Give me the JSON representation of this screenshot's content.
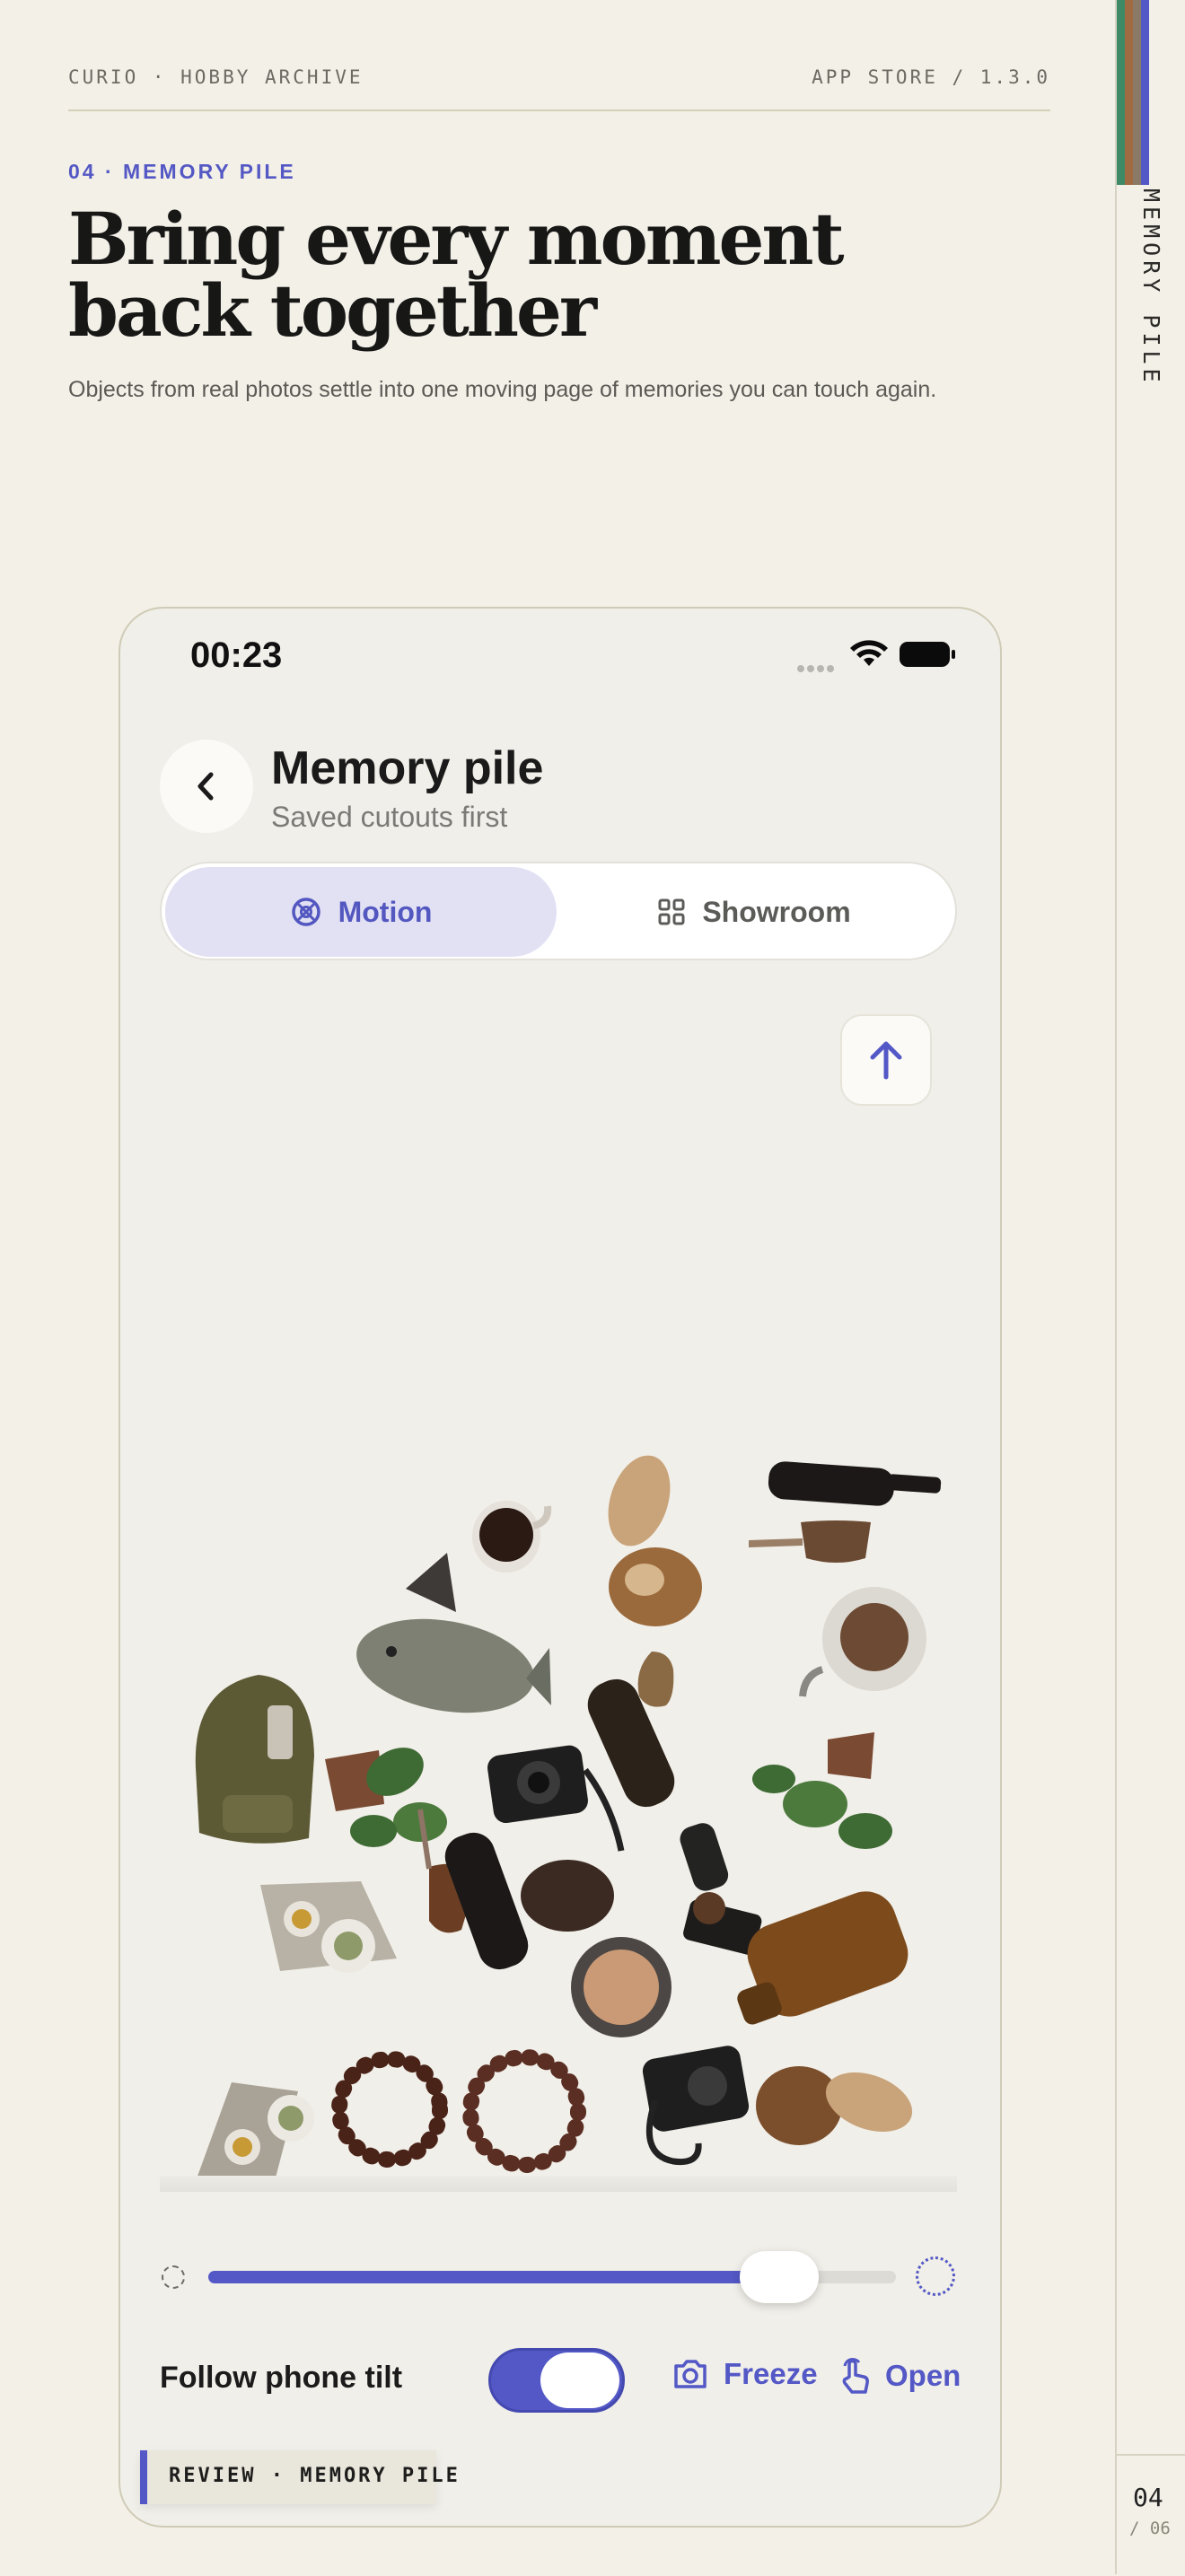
{
  "header": {
    "brand": "CURIO · HOBBY ARCHIVE",
    "release": "APP STORE / 1.3.0",
    "kicker": "04 · MEMORY PILE",
    "headline_line1": "Bring every moment",
    "headline_line2": "back together",
    "subtitle": "Objects from real photos settle into one moving page of memories you can touch again."
  },
  "sidebar": {
    "label": "MEMORY PILE",
    "page_number": "04",
    "page_total": "/ 06",
    "swatches": [
      "#3e8a67",
      "#a06a42",
      "#8a7a65",
      "#5358c6"
    ]
  },
  "status_bar": {
    "time": "00:23"
  },
  "screen": {
    "title": "Memory pile",
    "subtitle": "Saved cutouts first",
    "tabs": [
      {
        "label": "Motion",
        "icon": "motion-icon",
        "selected": true
      },
      {
        "label": "Showroom",
        "icon": "grid-icon",
        "selected": false
      }
    ],
    "pile_items": [
      "coffee cup",
      "bread",
      "wine bottle",
      "wine glass",
      "fish",
      "coffee maker",
      "backpack",
      "potted plant",
      "camera",
      "bottle",
      "potted plant",
      "coffee grinder",
      "tea set",
      "wine glass",
      "bottle",
      "compact mirror",
      "amber jar",
      "tea set",
      "bead bracelet",
      "bead bracelet",
      "camera",
      "bread"
    ],
    "slider_value": 0.83,
    "tilt_label": "Follow phone tilt",
    "tilt_enabled": true,
    "freeze_label": "Freeze",
    "open_label": "Open"
  },
  "footer": {
    "review_label": "REVIEW · MEMORY PILE"
  },
  "colors": {
    "accent": "#5358c6",
    "background": "#f3f0e8"
  }
}
